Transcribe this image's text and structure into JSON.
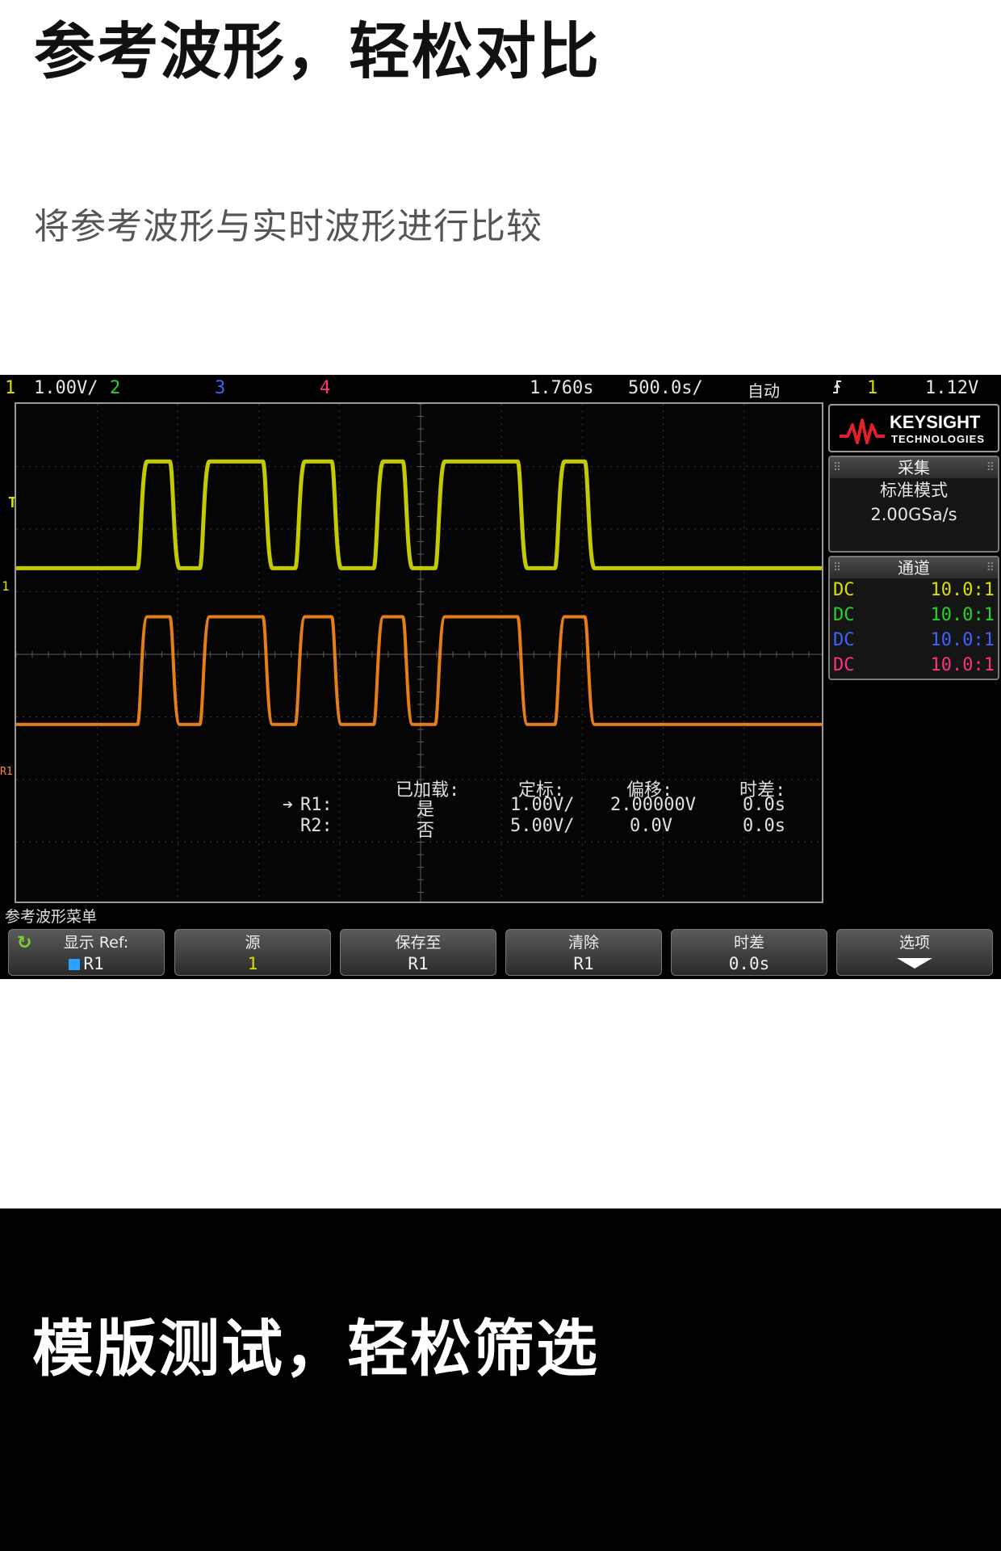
{
  "hero": {
    "title": "参考波形，轻松对比",
    "subtitle": "将参考波形与实时波形进行比较"
  },
  "scope": {
    "status": {
      "ch1_num": "1",
      "ch1_scale": "1.00V/",
      "ch2_num": "2",
      "ch3_num": "3",
      "ch4_num": "4",
      "time_delay": "1.760s",
      "time_scale": "500.0s/",
      "mode": "自动",
      "trigger_icon": "trigger-edge-icon",
      "trigger_channel": "1",
      "trigger_level": "1.12V"
    },
    "channel_colors": {
      "ch1": "#d8e000",
      "ch2": "#28d428",
      "ch3": "#4060ff",
      "ch4": "#ff3080",
      "ref": "#ff8c1a"
    },
    "side_markers": {
      "trigger_level_marker": "T",
      "ch1_ground_marker": "1",
      "ref1_ground_marker": "R1"
    },
    "ref_table": {
      "headers": [
        "已加载:",
        "定标:",
        "偏移:",
        "时差:"
      ],
      "rows": [
        {
          "name": "R1:",
          "loaded": "是",
          "scale": "1.00V/",
          "offset": "2.00000V",
          "skew": "0.0s"
        },
        {
          "name": "R2:",
          "loaded": "否",
          "scale": "5.00V/",
          "offset": "0.0V",
          "skew": "0.0s"
        }
      ]
    },
    "side_panel": {
      "logo_main": "KEYSIGHT",
      "logo_sub": "TECHNOLOGIES",
      "acq_title": "采集",
      "acq_mode": "标准模式",
      "acq_rate": "2.00GSa/s",
      "chan_title": "通道",
      "channels": [
        {
          "coupling": "DC",
          "probe": "10.0:1"
        },
        {
          "coupling": "DC",
          "probe": "10.0:1"
        },
        {
          "coupling": "DC",
          "probe": "10.0:1"
        },
        {
          "coupling": "DC",
          "probe": "10.0:1"
        }
      ]
    },
    "menu": {
      "title": "参考波形菜单",
      "softkeys": [
        {
          "label": "显示 Ref:",
          "value": "R1"
        },
        {
          "label": "源",
          "value": "1"
        },
        {
          "label": "保存至",
          "value": "R1"
        },
        {
          "label": "清除",
          "value": "R1"
        },
        {
          "label": "时差",
          "value": "0.0s"
        },
        {
          "label": "选项",
          "value": ""
        }
      ]
    }
  },
  "section2": {
    "title": "模版测试，轻松筛选"
  }
}
